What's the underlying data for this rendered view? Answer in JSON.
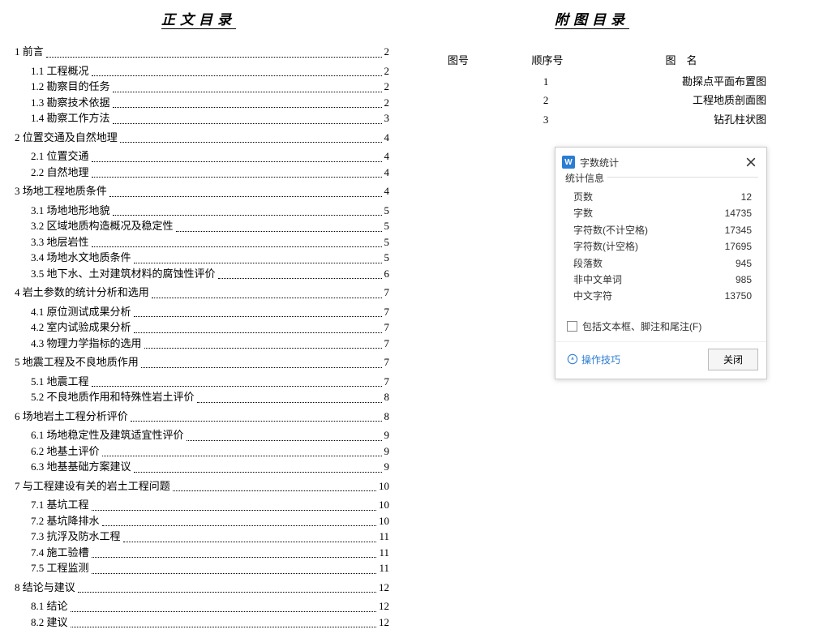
{
  "left": {
    "title": "正文目录",
    "items": [
      {
        "level": 1,
        "num": "1 ",
        "text": "前言",
        "page": "2"
      },
      {
        "level": 2,
        "num": "1.1 ",
        "text": "工程概况",
        "page": "2"
      },
      {
        "level": 2,
        "num": "1.2 ",
        "text": "勘察目的任务",
        "page": "2"
      },
      {
        "level": 2,
        "num": "1.3 ",
        "text": "勘察技术依据",
        "page": "2"
      },
      {
        "level": 2,
        "num": "1.4 ",
        "text": "勘察工作方法",
        "page": "3"
      },
      {
        "level": 1,
        "num": "2 ",
        "text": "位置交通及自然地理",
        "page": "4"
      },
      {
        "level": 2,
        "num": "2.1 ",
        "text": "位置交通",
        "page": "4"
      },
      {
        "level": 2,
        "num": "2.2 ",
        "text": "自然地理",
        "page": "4"
      },
      {
        "level": 1,
        "num": "3 ",
        "text": "场地工程地质条件",
        "page": "4"
      },
      {
        "level": 2,
        "num": "3.1 ",
        "text": "场地地形地貌",
        "page": "5"
      },
      {
        "level": 2,
        "num": "3.2 ",
        "text": "区域地质构造概况及稳定性",
        "page": "5"
      },
      {
        "level": 2,
        "num": "3.3 ",
        "text": "地层岩性",
        "page": "5"
      },
      {
        "level": 2,
        "num": "3.4 ",
        "text": "场地水文地质条件",
        "page": "5"
      },
      {
        "level": 2,
        "num": "3.5 ",
        "text": "地下水、土对建筑材料的腐蚀性评价",
        "page": "6"
      },
      {
        "level": 1,
        "num": "4 ",
        "text": "岩土参数的统计分析和选用",
        "page": "7"
      },
      {
        "level": 2,
        "num": "4.1 ",
        "text": "原位测试成果分析",
        "page": "7"
      },
      {
        "level": 2,
        "num": "4.2 ",
        "text": "室内试验成果分析",
        "page": "7"
      },
      {
        "level": 2,
        "num": "4.3 ",
        "text": "物理力学指标的选用",
        "page": "7"
      },
      {
        "level": 1,
        "num": "5 ",
        "text": "地震工程及不良地质作用",
        "page": "7"
      },
      {
        "level": 2,
        "num": "5.1 ",
        "text": "地震工程",
        "page": "7"
      },
      {
        "level": 2,
        "num": "5.2 ",
        "text": "不良地质作用和特殊性岩土评价",
        "page": "8"
      },
      {
        "level": 1,
        "num": "6 ",
        "text": "场地岩土工程分析评价",
        "page": "8"
      },
      {
        "level": 2,
        "num": "6.1 ",
        "text": "场地稳定性及建筑适宜性评价",
        "page": "9"
      },
      {
        "level": 2,
        "num": "6.2 ",
        "text": "地基土评价",
        "page": "9"
      },
      {
        "level": 2,
        "num": "6.3 ",
        "text": "地基基础方案建议",
        "page": "9"
      },
      {
        "level": 1,
        "num": "7 ",
        "text": "与工程建设有关的岩土工程问题",
        "page": "10"
      },
      {
        "level": 2,
        "num": "7.1 ",
        "text": "基坑工程",
        "page": "10"
      },
      {
        "level": 2,
        "num": "7.2 ",
        "text": "基坑降排水",
        "page": "10"
      },
      {
        "level": 2,
        "num": "7.3 ",
        "text": "抗浮及防水工程",
        "page": "11"
      },
      {
        "level": 2,
        "num": "7.4 ",
        "text": "施工验槽",
        "page": "11"
      },
      {
        "level": 2,
        "num": "7.5 ",
        "text": "工程监测",
        "page": "11"
      },
      {
        "level": 1,
        "num": "8 ",
        "text": "结论与建议",
        "page": "12"
      },
      {
        "level": 2,
        "num": "8.1 ",
        "text": "结论",
        "page": "12"
      },
      {
        "level": 2,
        "num": "8.2 ",
        "text": "建议",
        "page": "12"
      }
    ]
  },
  "right": {
    "title": "附图目录",
    "cols": {
      "c1": "图号",
      "c2": "顺序号",
      "c3": "图　名"
    },
    "rows": [
      {
        "c1": "",
        "c2": "1",
        "c3": "勘探点平面布置图"
      },
      {
        "c1": "",
        "c2": "2",
        "c3": "工程地质剖面图"
      },
      {
        "c1": "",
        "c2": "3",
        "c3": "钻孔柱状图"
      }
    ]
  },
  "dialog": {
    "app_icon": "W",
    "title": "字数统计",
    "group": "统计信息",
    "stats": [
      {
        "k": "页数",
        "v": "12"
      },
      {
        "k": "字数",
        "v": "14735"
      },
      {
        "k": "字符数(不计空格)",
        "v": "17345"
      },
      {
        "k": "字符数(计空格)",
        "v": "17695"
      },
      {
        "k": "段落数",
        "v": "945"
      },
      {
        "k": "非中文单词",
        "v": "985"
      },
      {
        "k": "中文字符",
        "v": "13750"
      }
    ],
    "checkbox": "包括文本框、脚注和尾注(F)",
    "tip": "操作技巧",
    "close": "关闭"
  }
}
